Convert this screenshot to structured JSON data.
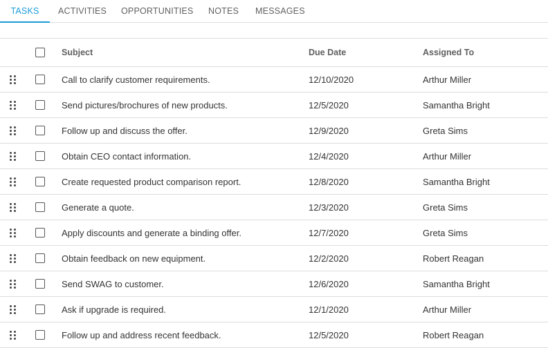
{
  "tabs": [
    {
      "label": "TASKS",
      "active": true
    },
    {
      "label": "ACTIVITIES",
      "active": false
    },
    {
      "label": "OPPORTUNITIES",
      "active": false
    },
    {
      "label": "NOTES",
      "active": false
    },
    {
      "label": "MESSAGES",
      "active": false
    }
  ],
  "accent_color": "#1a9bd7",
  "columns": {
    "subject": "Subject",
    "due_date": "Due Date",
    "assigned_to": "Assigned To"
  },
  "rows": [
    {
      "subject": "Call to clarify customer requirements.",
      "due_date": "12/10/2020",
      "assigned_to": "Arthur Miller"
    },
    {
      "subject": "Send pictures/brochures of new products.",
      "due_date": "12/5/2020",
      "assigned_to": "Samantha Bright"
    },
    {
      "subject": "Follow up and discuss the offer.",
      "due_date": "12/9/2020",
      "assigned_to": "Greta Sims"
    },
    {
      "subject": "Obtain CEO contact information.",
      "due_date": "12/4/2020",
      "assigned_to": "Arthur Miller"
    },
    {
      "subject": "Create requested product comparison report.",
      "due_date": "12/8/2020",
      "assigned_to": "Samantha Bright"
    },
    {
      "subject": "Generate a quote.",
      "due_date": "12/3/2020",
      "assigned_to": "Greta Sims"
    },
    {
      "subject": "Apply discounts and generate a binding offer.",
      "due_date": "12/7/2020",
      "assigned_to": "Greta Sims"
    },
    {
      "subject": "Obtain feedback on new equipment.",
      "due_date": "12/2/2020",
      "assigned_to": "Robert Reagan"
    },
    {
      "subject": "Send SWAG to customer.",
      "due_date": "12/6/2020",
      "assigned_to": "Samantha Bright"
    },
    {
      "subject": "Ask if upgrade is required.",
      "due_date": "12/1/2020",
      "assigned_to": "Arthur Miller"
    },
    {
      "subject": "Follow up and address recent feedback.",
      "due_date": "12/5/2020",
      "assigned_to": "Robert Reagan"
    }
  ]
}
